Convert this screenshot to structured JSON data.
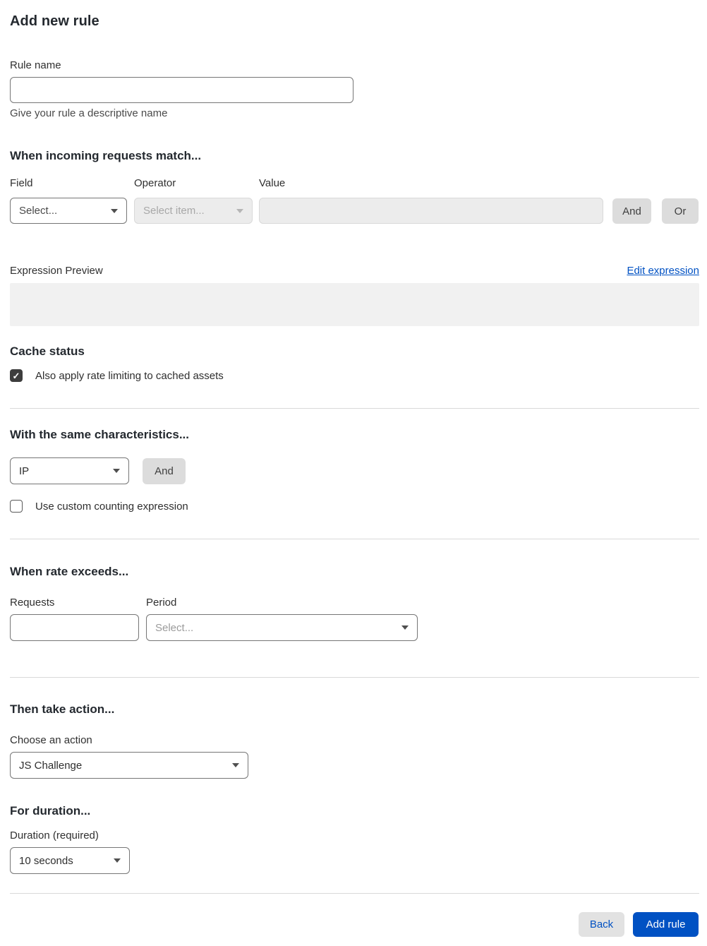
{
  "page": {
    "title": "Add new rule"
  },
  "colors": {
    "accent_blue": "#0051c3",
    "divider": "#d9d9d9",
    "disabled_bg": "#ececec",
    "checkbox_checked": "#3d3d3d",
    "preview_bg": "#f1f1f1"
  },
  "rule_name": {
    "label": "Rule name",
    "value": "",
    "helper": "Give your rule a descriptive name"
  },
  "match_section": {
    "heading": "When incoming requests match...",
    "field": {
      "label": "Field",
      "selected": "Select..."
    },
    "operator": {
      "label": "Operator",
      "selected": "Select item...",
      "disabled": true
    },
    "value": {
      "label": "Value",
      "value": "",
      "disabled": true
    },
    "and_button": "And",
    "or_button": "Or",
    "expression_preview_label": "Expression Preview",
    "edit_expression_link": "Edit expression",
    "expression_preview_value": ""
  },
  "cache_section": {
    "heading": "Cache status",
    "checkbox_label": "Also apply rate limiting to cached assets",
    "checked": true,
    "check_glyph": "✓"
  },
  "characteristics_section": {
    "heading": "With the same characteristics...",
    "characteristic_select": {
      "selected": "IP"
    },
    "and_button": "And",
    "checkbox_label": "Use custom counting expression",
    "checked": false
  },
  "rate_section": {
    "heading": "When rate exceeds...",
    "requests": {
      "label": "Requests",
      "value": ""
    },
    "period": {
      "label": "Period",
      "selected": "Select..."
    }
  },
  "action_section": {
    "heading": "Then take action...",
    "choose_label": "Choose an action",
    "action_select": {
      "selected": "JS Challenge"
    }
  },
  "duration_section": {
    "heading": "For duration...",
    "label": "Duration (required)",
    "duration_select": {
      "selected": "10 seconds"
    }
  },
  "footer": {
    "back_label": "Back",
    "add_rule_label": "Add rule"
  }
}
